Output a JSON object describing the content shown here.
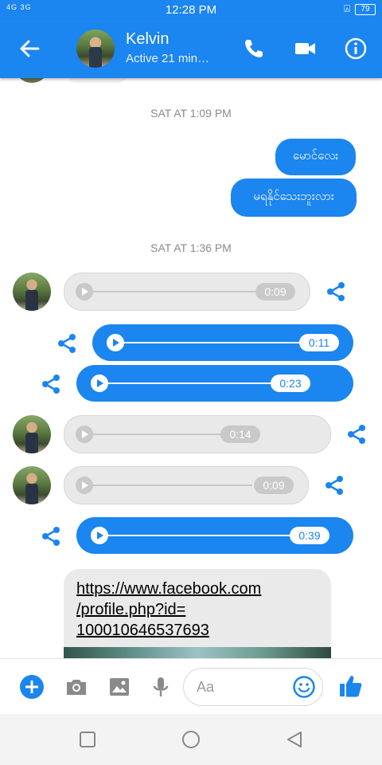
{
  "status_bar": {
    "signal": "4G 3G",
    "time": "12:28 PM",
    "battery": "79"
  },
  "header": {
    "contact_name": "Kelvin",
    "status": "Active 21 min…",
    "icons": [
      "back-arrow-icon",
      "phone-icon",
      "video-camera-icon",
      "info-icon"
    ]
  },
  "conversation": {
    "timestamps": [
      "SAT AT 1:09 PM",
      "SAT AT 1:36 PM"
    ],
    "sent_texts": [
      "မောင်လေး",
      "မရနိုင်သေးဘူးလား"
    ],
    "audio_messages": [
      {
        "direction": "incoming",
        "duration": "0:09"
      },
      {
        "direction": "outgoing",
        "duration": "0:11"
      },
      {
        "direction": "outgoing",
        "duration": "0:23"
      },
      {
        "direction": "incoming",
        "duration": "0:14"
      },
      {
        "direction": "incoming",
        "duration": "0:09"
      },
      {
        "direction": "outgoing",
        "duration": "0:39"
      }
    ],
    "link": {
      "url": "https://www.facebook.com/profile.php?id=100010646537693",
      "lines": [
        "https://www.facebook.com",
        "/profile.php?id=",
        "100010646537693"
      ]
    }
  },
  "composer": {
    "placeholder": "Aa",
    "icons": [
      "plus-icon",
      "camera-icon",
      "image-icon",
      "microphone-icon",
      "emoji-icon",
      "thumbs-up-icon"
    ]
  },
  "navbar": {
    "icons": [
      "recents-square-icon",
      "home-circle-icon",
      "back-triangle-icon"
    ]
  },
  "colors": {
    "accent": "#1b85f0",
    "incoming_bubble": "#e9e9e9",
    "timestamp_text": "#8a8a8a"
  }
}
